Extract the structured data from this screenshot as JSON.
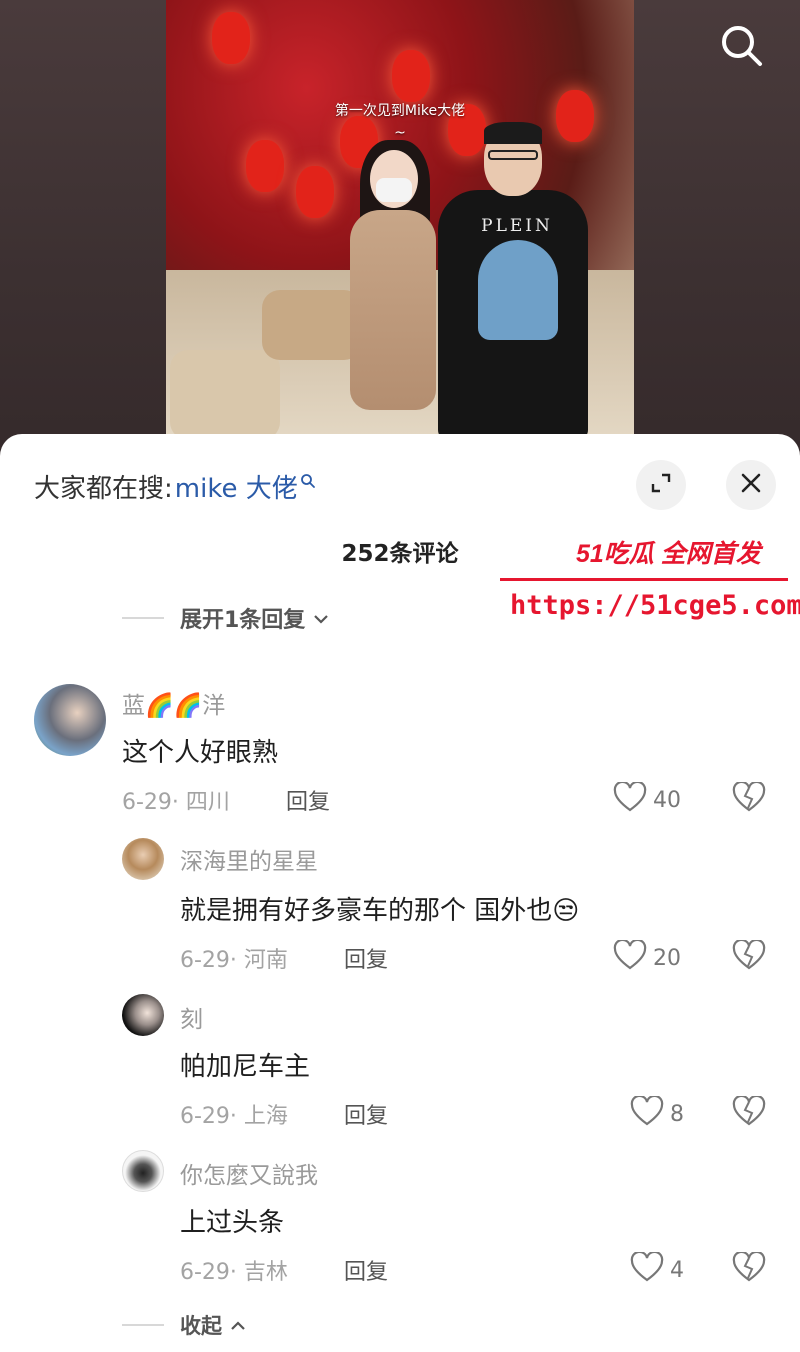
{
  "video": {
    "caption_line1": "第一次见到Mike大佬",
    "caption_line2": "~",
    "hoodie_text": "PLEIN"
  },
  "top_bar": {
    "search_icon": "search-icon"
  },
  "sheet": {
    "search_prefix": "大家都在搜:",
    "search_keyword": "mike 大佬",
    "expand_icon": "expand-icon",
    "close_icon": "close-icon",
    "comment_count": "252条评论",
    "expand_replies": "展开1条回复",
    "collapse": "收起"
  },
  "watermark": {
    "title": "51吃瓜 全网首发",
    "url": "https://51cge5.com"
  },
  "comments": [
    {
      "name": "蓝🌈🌈洋",
      "text": "这个人好眼熟",
      "meta": "6-29· 四川",
      "reply": "回复",
      "likes": "40"
    },
    {
      "name": "深海里的星星",
      "text": "就是拥有好多豪车的那个 国外也😒",
      "meta": "6-29· 河南",
      "reply": "回复",
      "likes": "20"
    },
    {
      "name": "刻",
      "text": "帕加尼车主",
      "meta": "6-29· 上海",
      "reply": "回复",
      "likes": "8"
    },
    {
      "name": "你怎麼又說我",
      "text": "上过头条",
      "meta": "6-29· 吉林",
      "reply": "回复",
      "likes": "4"
    }
  ],
  "colors": {
    "keyword": "#2b5ba8",
    "watermark": "#e6162f"
  }
}
